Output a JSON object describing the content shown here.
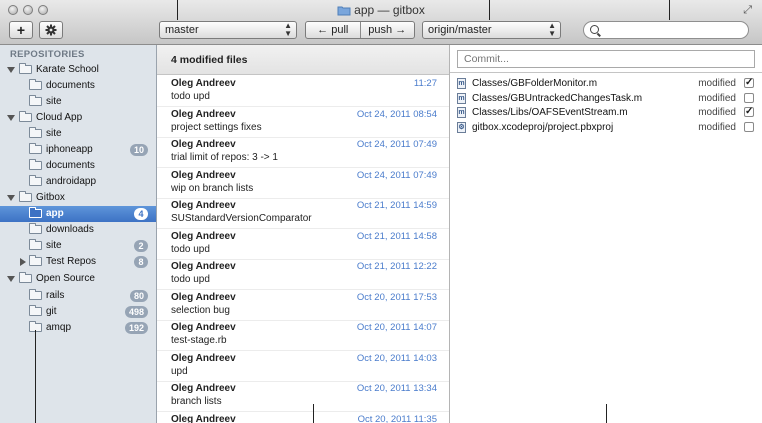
{
  "window": {
    "title": "app — gitbox"
  },
  "toolbar": {
    "add_label": "+",
    "local_branch": "master",
    "pull_label": "← pull",
    "push_label": "push →",
    "remote_branch": "origin/master",
    "search_placeholder": ""
  },
  "sidebar": {
    "heading": "REPOSITORIES",
    "groups": [
      {
        "name": "Karate School",
        "items": [
          {
            "label": "documents"
          },
          {
            "label": "site"
          }
        ]
      },
      {
        "name": "Cloud App",
        "items": [
          {
            "label": "site"
          },
          {
            "label": "iphoneapp",
            "badge": "10"
          },
          {
            "label": "documents"
          },
          {
            "label": "androidapp"
          }
        ]
      },
      {
        "name": "Gitbox",
        "items": [
          {
            "label": "app",
            "badge": "4",
            "selected": true
          },
          {
            "label": "downloads"
          },
          {
            "label": "site",
            "badge": "2"
          },
          {
            "label": "Test Repos",
            "badge": "8",
            "collapsed": true
          }
        ]
      },
      {
        "name": "Open Source",
        "items": [
          {
            "label": "rails",
            "badge": "80"
          },
          {
            "label": "git",
            "badge": "498"
          },
          {
            "label": "amqp",
            "badge": "192"
          }
        ]
      }
    ]
  },
  "history": {
    "header": "4 modified files",
    "commits": [
      {
        "author": "Oleg Andreev",
        "date": "11:27",
        "message": "todo upd"
      },
      {
        "author": "Oleg Andreev",
        "date": "Oct 24, 2011 08:54",
        "message": "project settings fixes"
      },
      {
        "author": "Oleg Andreev",
        "date": "Oct 24, 2011 07:49",
        "message": "trial limit of repos: 3 -> 1"
      },
      {
        "author": "Oleg Andreev",
        "date": "Oct 24, 2011 07:49",
        "message": "wip on branch lists"
      },
      {
        "author": "Oleg Andreev",
        "date": "Oct 21, 2011 14:59",
        "message": "SUStandardVersionComparator"
      },
      {
        "author": "Oleg Andreev",
        "date": "Oct 21, 2011 14:58",
        "message": "todo upd"
      },
      {
        "author": "Oleg Andreev",
        "date": "Oct 21, 2011 12:22",
        "message": "todo upd"
      },
      {
        "author": "Oleg Andreev",
        "date": "Oct 20, 2011 17:53",
        "message": "selection bug"
      },
      {
        "author": "Oleg Andreev",
        "date": "Oct 20, 2011 14:07",
        "message": "test-stage.rb"
      },
      {
        "author": "Oleg Andreev",
        "date": "Oct 20, 2011 14:03",
        "message": "upd"
      },
      {
        "author": "Oleg Andreev",
        "date": "Oct 20, 2011 13:34",
        "message": "branch lists"
      },
      {
        "author": "Oleg Andreev",
        "date": "Oct 20, 2011 11:35",
        "message": ""
      }
    ]
  },
  "changes": {
    "commit_placeholder": "Commit...",
    "files": [
      {
        "path": "Classes/GBFolderMonitor.m",
        "status": "modified",
        "checked": true,
        "icon": "m-file-icon"
      },
      {
        "path": "Classes/GBUntrackedChangesTask.m",
        "status": "modified",
        "checked": false,
        "icon": "m-file-icon"
      },
      {
        "path": "Classes/Libs/OAFSEventStream.m",
        "status": "modified",
        "checked": true,
        "icon": "m-file-icon"
      },
      {
        "path": "gitbox.xcodeproj/project.pbxproj",
        "status": "modified",
        "checked": false,
        "icon": "gear-file-icon"
      }
    ]
  }
}
